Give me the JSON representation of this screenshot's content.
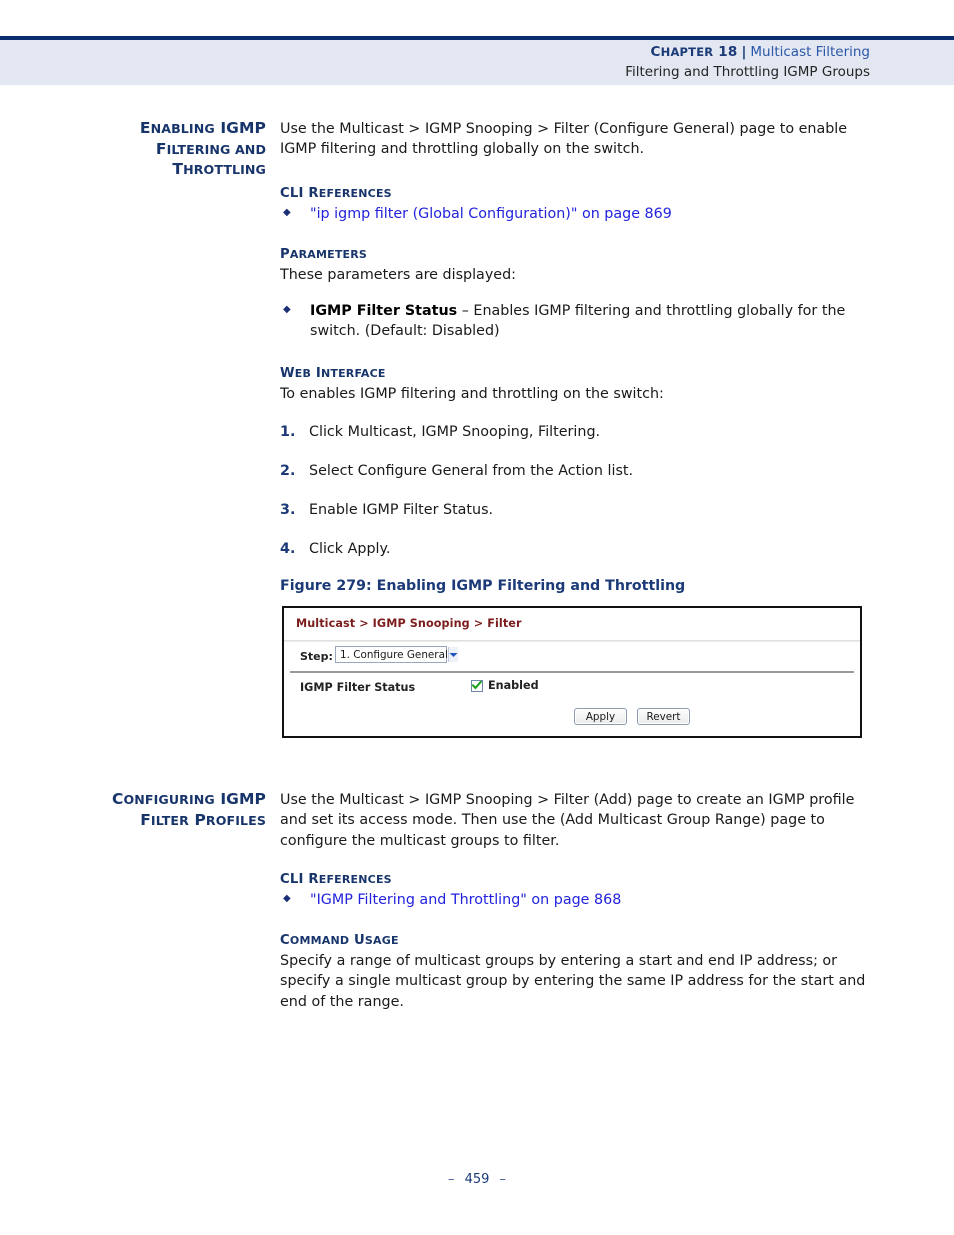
{
  "header": {
    "chapter_label": "CHAPTER 18",
    "chapter_label_head": "C",
    "chapter_label_rest": "HAPTER",
    "chapter_number": "18",
    "separator": "|",
    "chapter_title": "Multicast Filtering",
    "subtitle": "Filtering and Throttling IGMP Groups"
  },
  "section1": {
    "side_heading": {
      "line1_a": "E",
      "line1_b": "NABLING",
      "line1_c": "IGMP",
      "line2_a": "F",
      "line2_b": "ILTERING AND",
      "line3_a": "T",
      "line3_b": "HROTTLING"
    },
    "intro": "Use the Multicast > IGMP Snooping > Filter (Configure General) page to enable IGMP filtering and throttling globally on the switch.",
    "cli_refs_heading_a": "CLI R",
    "cli_refs_heading_b": "EFERENCES",
    "cli_ref_link": "\"ip igmp filter (Global Configuration)\" on page 869",
    "parameters_heading_a": "P",
    "parameters_heading_b": "ARAMETERS",
    "parameters_intro": "These parameters are displayed:",
    "parameter_term": "IGMP Filter Status",
    "parameter_desc": " – Enables IGMP filtering and throttling globally for the switch. (Default: Disabled)",
    "web_interface_heading_a": "W",
    "web_interface_heading_b": "EB",
    "web_interface_heading_c": "I",
    "web_interface_heading_d": "NTERFACE",
    "web_interface_intro": "To enables IGMP filtering and throttling on the switch:",
    "steps": [
      {
        "num": "1.",
        "text": "Click Multicast, IGMP Snooping, Filtering."
      },
      {
        "num": "2.",
        "text": "Select Configure General from the Action list."
      },
      {
        "num": "3.",
        "text": "Enable IGMP Filter Status."
      },
      {
        "num": "4.",
        "text": "Click Apply."
      }
    ],
    "figure_caption_label": "Figure 279:",
    "figure_caption_title": "Enabling IGMP Filtering and Throttling"
  },
  "screenshot": {
    "breadcrumb": "Multicast > IGMP Snooping > Filter",
    "step_label": "Step:",
    "step_value": "1. Configure General",
    "field_label": "IGMP Filter Status",
    "checkbox_label": "Enabled",
    "checkbox_checked": true,
    "apply_button": "Apply",
    "revert_button": "Revert"
  },
  "section2": {
    "side_heading": {
      "line1_a": "C",
      "line1_b": "ONFIGURING",
      "line1_c": "IGMP",
      "line2_a": "F",
      "line2_b": "ILTER",
      "line2_c": "P",
      "line2_d": "ROFILES"
    },
    "intro": "Use the Multicast > IGMP Snooping > Filter (Add) page to create an IGMP profile and set its access mode. Then use the (Add Multicast Group Range) page to configure the multicast groups to filter.",
    "cli_refs_heading_a": "CLI R",
    "cli_refs_heading_b": "EFERENCES",
    "cli_ref_link": "\"IGMP Filtering and Throttling\" on page 868",
    "command_usage_heading_a": "C",
    "command_usage_heading_b": "OMMAND",
    "command_usage_heading_c": "U",
    "command_usage_heading_d": "SAGE",
    "command_usage_text": "Specify a range of multicast groups by entering a start and end IP address; or specify a single multicast group by entering the same IP address for the start and end of the range."
  },
  "footer": {
    "dash_left": "–",
    "page_number": "459",
    "dash_right": "–"
  },
  "colors": {
    "navy": "#18356b",
    "header_rule": "#0b2d6e",
    "header_band": "#e3e7f1",
    "link_blue": "#2222dd",
    "crumb_maroon": "#7c1d1d"
  }
}
